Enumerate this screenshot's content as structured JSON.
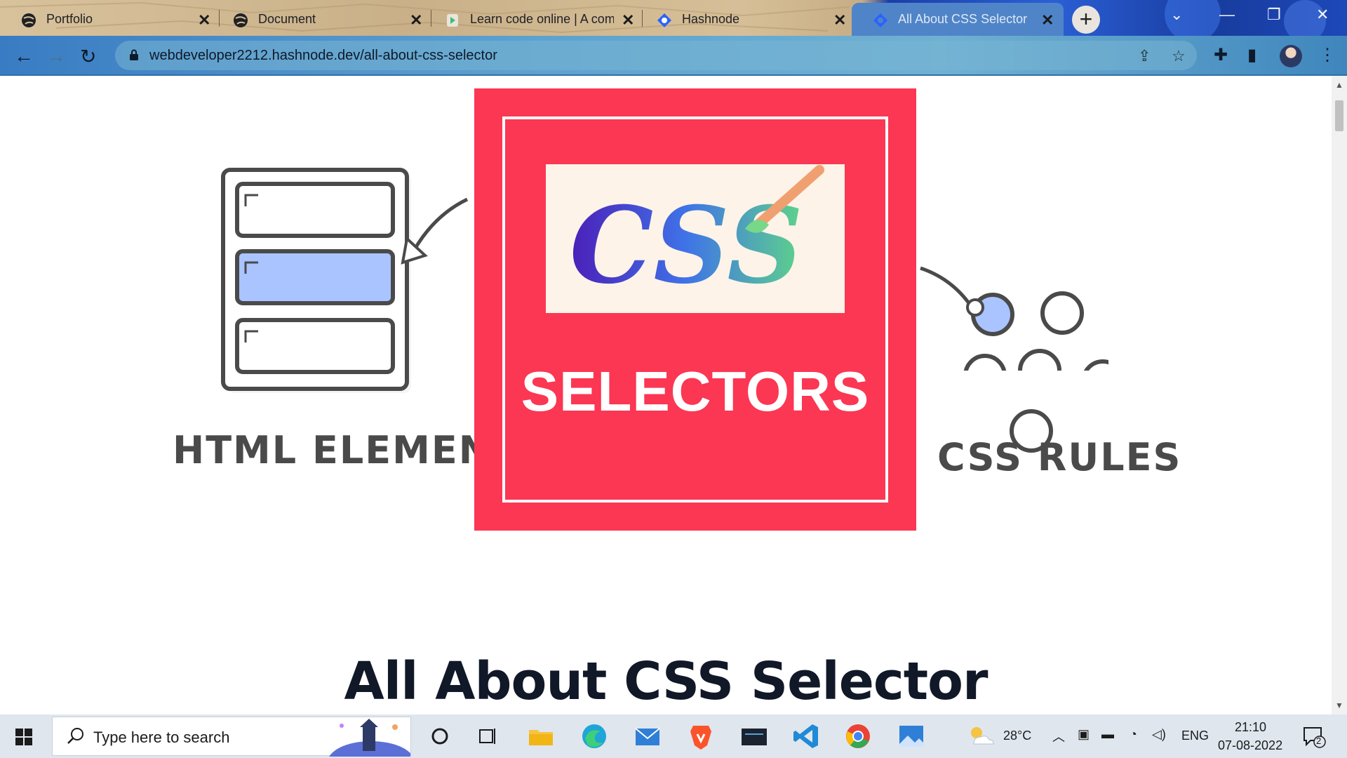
{
  "tabs": [
    {
      "title": "Portfolio",
      "icon": "globe-icon"
    },
    {
      "title": "Document",
      "icon": "globe-icon"
    },
    {
      "title": "Learn code online | A com",
      "icon": "scrimba-icon"
    },
    {
      "title": "Hashnode",
      "icon": "hashnode-icon"
    },
    {
      "title": "All About CSS Selector",
      "icon": "hashnode-icon",
      "active": true
    }
  ],
  "address_bar": {
    "url": "webdeveloper2212.hashnode.dev/all-about-css-selector"
  },
  "hero_image": {
    "left_label": "HTML ELEMENTS",
    "center_logo_text": "CSS",
    "center_label": "SELECTORS",
    "right_label": "CSS RULES",
    "accent_color": "#fb3753"
  },
  "article": {
    "title": "All About CSS Selector"
  },
  "taskbar": {
    "search_placeholder": "Type here to search",
    "weather": "28°C",
    "language": "ENG",
    "time": "21:10",
    "date": "07-08-2022",
    "notification_count": "2"
  }
}
